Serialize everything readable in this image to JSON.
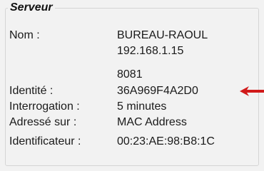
{
  "group": {
    "title": "Serveur"
  },
  "fields": {
    "name": {
      "label": "Nom :",
      "value": "BUREAU-RAOUL"
    },
    "ip": {
      "value": "192.168.1.15"
    },
    "port": {
      "value": "8081"
    },
    "identity": {
      "label": "Identité :",
      "value": "36A969F4A2D0"
    },
    "polling": {
      "label": "Interrogation :",
      "value": "5 minutes"
    },
    "addressed_on": {
      "label": "Adressé sur :",
      "value": "MAC Address"
    },
    "identifier": {
      "label": "Identificateur :",
      "value": "00:23:AE:98:B8:1C"
    }
  },
  "colors": {
    "arrow": "#d11a1a"
  },
  "icons": {
    "pointer": "arrow-left-icon"
  }
}
